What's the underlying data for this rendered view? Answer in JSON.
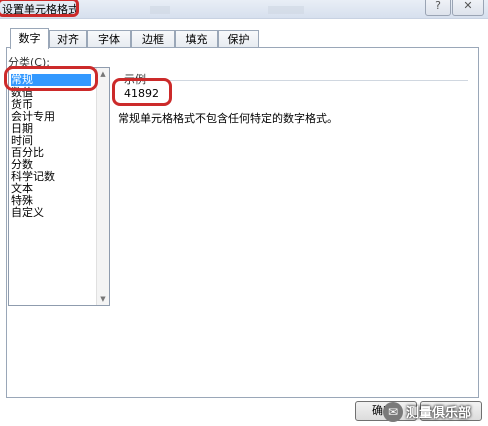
{
  "dialog": {
    "title": "设置单元格格式"
  },
  "tabs": [
    {
      "label": "数字",
      "active": true
    },
    {
      "label": "对齐",
      "active": false
    },
    {
      "label": "字体",
      "active": false
    },
    {
      "label": "边框",
      "active": false
    },
    {
      "label": "填充",
      "active": false
    },
    {
      "label": "保护",
      "active": false
    }
  ],
  "category": {
    "label": "分类(C):",
    "selected": "常规",
    "items": [
      "常规",
      "数值",
      "货币",
      "会计专用",
      "日期",
      "时间",
      "百分比",
      "分数",
      "科学记数",
      "文本",
      "特殊",
      "自定义"
    ]
  },
  "sample": {
    "label": "示例",
    "value": "41892"
  },
  "description": "常规单元格格式不包含任何特定的数字格式。",
  "buttons": {
    "ok_label": "确定"
  },
  "watermark": {
    "text": "测量俱乐部"
  },
  "colors": {
    "highlight": "#cc2a2a",
    "selection": "#3399ff"
  }
}
